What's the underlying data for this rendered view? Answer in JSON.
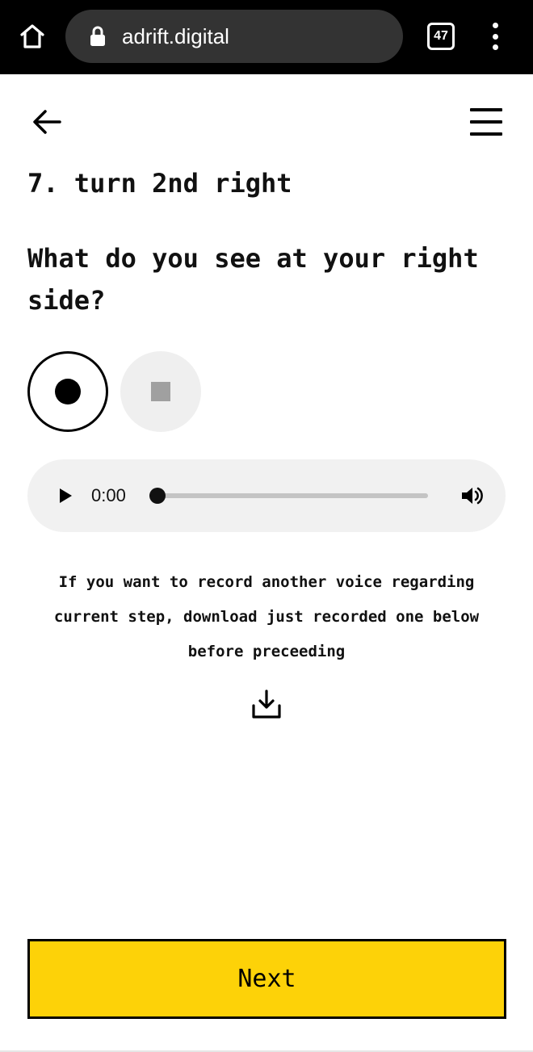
{
  "browser": {
    "url": "adrift.digital",
    "tab_count": "47"
  },
  "step": {
    "title": "7. turn 2nd right",
    "question": "What do you see at your right side?"
  },
  "recorder": {
    "record_icon": "record-icon",
    "stop_icon": "stop-icon"
  },
  "audio": {
    "time": "0:00",
    "progress": 0
  },
  "info": {
    "text": "If you want to record another voice regarding current step, download just recorded one below before preceeding"
  },
  "footer": {
    "next_label": "Next"
  },
  "colors": {
    "accent": "#fdd208",
    "browser_bar": "#000000",
    "url_pill": "#333333"
  }
}
